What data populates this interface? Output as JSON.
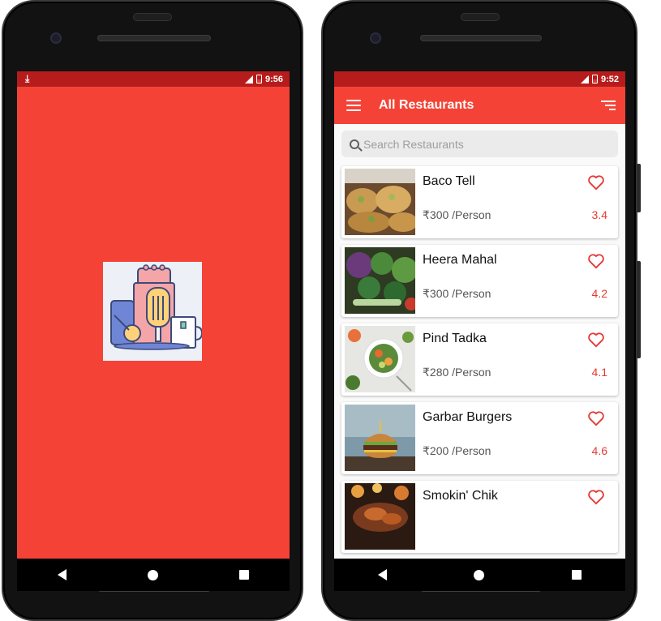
{
  "splash": {
    "status": {
      "time": "9:56"
    }
  },
  "list_screen": {
    "status": {
      "time": "9:52"
    },
    "toolbar": {
      "title": "All Restaurants"
    },
    "search": {
      "placeholder": "Search Restaurants"
    },
    "restaurants": [
      {
        "name": "Baco Tell",
        "price": "₹300 /Person",
        "rating": "3.4"
      },
      {
        "name": "Heera Mahal",
        "price": "₹300 /Person",
        "rating": "4.2"
      },
      {
        "name": "Pind Tadka",
        "price": "₹280 /Person",
        "rating": "4.1"
      },
      {
        "name": "Garbar Burgers",
        "price": "₹200 /Person",
        "rating": "4.6"
      },
      {
        "name": "Smokin' Chik",
        "price": "",
        "rating": ""
      }
    ]
  },
  "colors": {
    "primary": "#f44336",
    "status_bar": "#b71c1c",
    "accent": "#e53935"
  },
  "icons": [
    "download-icon",
    "signal-icon",
    "battery-icon",
    "menu-icon",
    "sort-icon",
    "search-icon",
    "heart-outline-icon",
    "back-icon",
    "home-icon",
    "recents-icon"
  ]
}
